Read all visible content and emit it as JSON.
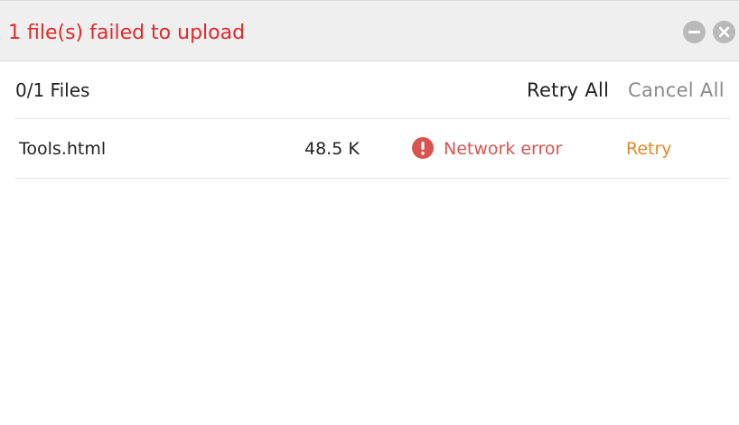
{
  "header": {
    "title": "1 file(s) failed to upload",
    "title_color": "#e02a2a",
    "minimize_icon": "minimize-icon",
    "close_icon": "close-icon"
  },
  "toolbar": {
    "count_label": "0/1 Files",
    "retry_all_label": "Retry All",
    "cancel_all_label": "Cancel All"
  },
  "files": [
    {
      "name": "Tools.html",
      "size": "48.5 K",
      "status_icon": "error-icon",
      "status": "Network error",
      "status_color": "#d9534f",
      "action_label": "Retry",
      "action_color": "#e08a2a"
    }
  ]
}
